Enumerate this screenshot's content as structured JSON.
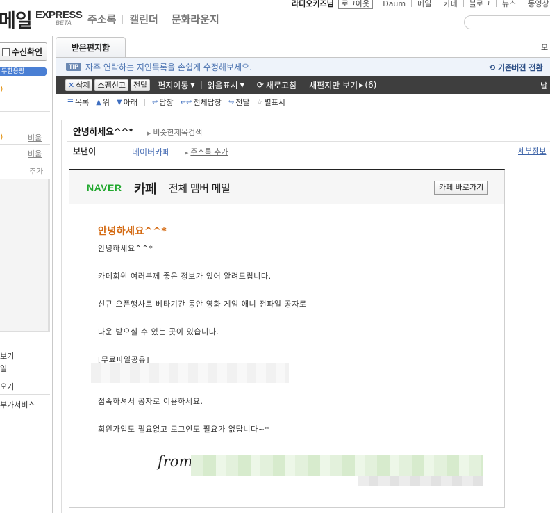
{
  "header": {
    "logo_main": "메일",
    "logo_express": "EXPRESS",
    "logo_beta": "BETA",
    "topnav": [
      "주소록",
      "캘린더",
      "문화라운지"
    ],
    "username": "라디오키즈님",
    "logout": "로그아웃",
    "util_links": [
      "Daum",
      "메일",
      "카페",
      "블로그",
      "뉴스",
      "동영상"
    ]
  },
  "sidebar": {
    "check_mail": "수신확인",
    "unlimited": "무한용량",
    "paren_top": ")",
    "paren1": ")",
    "link1": "비움",
    "link2": "비움",
    "add": "추가",
    "bottom_items": [
      "보기",
      "일",
      "오기",
      "부가서비스"
    ]
  },
  "tabs": {
    "inbox": "받은편지함",
    "right_text": "모"
  },
  "tip": {
    "badge": "TIP",
    "text": "자주 연락하는 지인목록을 손쉽게 수정해보세요.",
    "right": "기존버전 전환"
  },
  "toolbar": {
    "delete": "삭제",
    "spam": "스팸신고",
    "forward": "전달",
    "move": "편지이동",
    "read_mark": "읽음표시",
    "refresh": "새로고침",
    "new_only": "새편지만 보기",
    "new_count": "(6)",
    "right": "날"
  },
  "toolbar2": {
    "list": "목록",
    "up": "위",
    "down": "아래",
    "reply": "답장",
    "reply_all": "전체답장",
    "forward": "전달",
    "star": "별표시"
  },
  "message": {
    "subject": "안녕하세요^^*",
    "similar": "비슷한제목검색",
    "sender_label": "보낸이",
    "sender_name": "네이버카페",
    "add_contact": "주소록 추가",
    "detail": "세부정보"
  },
  "mail": {
    "naver": "NAVER",
    "cafe": "카페",
    "all_member": "전체 멤버 메일",
    "goto_cafe": "카페 바로가기",
    "title": "안녕하세요^^*",
    "lines": [
      "안녕하세요^^*",
      "카페회원 여러분께 좋은 정보가 있어 알려드립니다.",
      "신규 오픈행사로 베타기간 동안 영화 게임 애니 전파일 공자로",
      "다운 받으실 수 있는 곳이 있습니다.",
      "[무료파일공유]",
      "접속하셔서 공자로 이용하세요.",
      "회원가입도 필요없고 로그인도 필요가 없답니다~*"
    ],
    "from": "from"
  }
}
